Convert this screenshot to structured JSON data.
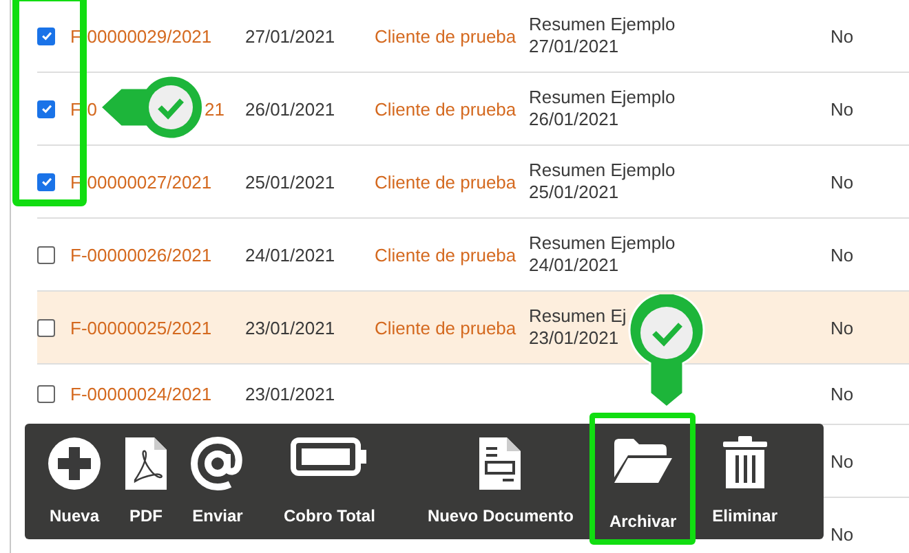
{
  "rows": [
    {
      "checked": true,
      "highlighted": false,
      "number": "F-00000029/2021",
      "date": "27/01/2021",
      "client": "Cliente de prueba",
      "summary": "Resumen Ejemplo",
      "summary_date": "27/01/2021",
      "archived": "No"
    },
    {
      "checked": true,
      "highlighted": false,
      "number": "F-0",
      "number_end": "21",
      "date": "26/01/2021",
      "client": "Cliente de prueba",
      "summary": "Resumen Ejemplo",
      "summary_date": "26/01/2021",
      "archived": "No"
    },
    {
      "checked": true,
      "highlighted": false,
      "number": "F-00000027/2021",
      "date": "25/01/2021",
      "client": "Cliente de prueba",
      "summary": "Resumen Ejemplo",
      "summary_date": "25/01/2021",
      "archived": "No"
    },
    {
      "checked": false,
      "highlighted": false,
      "number": "F-00000026/2021",
      "date": "24/01/2021",
      "client": "Cliente de prueba",
      "summary": "Resumen Ejemplo",
      "summary_date": "24/01/2021",
      "archived": "No"
    },
    {
      "checked": false,
      "highlighted": true,
      "number": "F-00000025/2021",
      "date": "23/01/2021",
      "client": "Cliente de prueba",
      "summary": "Resumen Ej",
      "summary_date": "23/01/2021",
      "archived": "No"
    },
    {
      "checked": false,
      "highlighted": false,
      "number": "F-00000024/2021",
      "date": "23/01/2021",
      "archived": "No"
    },
    {
      "archived": "No"
    },
    {
      "archived": "No"
    }
  ],
  "toolbar": [
    {
      "kind": "plus",
      "label": "Nueva",
      "framed": false
    },
    {
      "kind": "pdf",
      "label": "PDF",
      "framed": false
    },
    {
      "kind": "at",
      "label": "Enviar",
      "framed": false
    },
    {
      "kind": "battery",
      "label": "Cobro Total",
      "framed": false
    },
    {
      "kind": "document",
      "label": "Nuevo Documento",
      "framed": false
    },
    {
      "kind": "folder",
      "label": "Archivar",
      "framed": true
    },
    {
      "kind": "trash",
      "label": "Eliminar",
      "framed": false
    }
  ]
}
